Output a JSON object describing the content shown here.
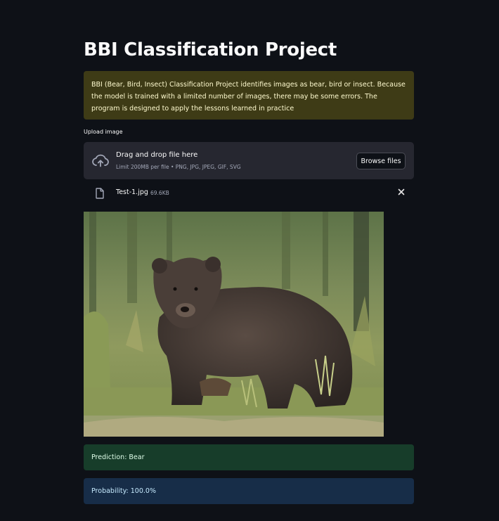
{
  "page": {
    "title": "BBI Classification Project",
    "description": "BBI (Bear, Bird, Insect) Classification Project identifies images as bear, bird or insect. Because the model is trained with a limited number of images, there may be some errors. The program is designed to apply the lessons learned in practice"
  },
  "uploader": {
    "label": "Upload image",
    "dropzone_title": "Drag and drop file here",
    "dropzone_limit": "Limit 200MB per file • PNG, JPG, JPEG, GIF, SVG",
    "browse_label": "Browse files",
    "icon": "cloud-upload-icon"
  },
  "uploaded_file": {
    "name": "Test-1.jpg",
    "size": "69.6KB",
    "icon": "file-icon",
    "remove_icon": "close-icon"
  },
  "image": {
    "subject": "brown bear standing in grass"
  },
  "result": {
    "prediction": "Prediction: Bear",
    "probability": "Probability: 100.0%"
  },
  "colors": {
    "background": "#0e1117",
    "info_box": "#3e3b16",
    "success_box": "#173d2a",
    "info_alert": "#172d48",
    "dropzone": "#262730"
  }
}
